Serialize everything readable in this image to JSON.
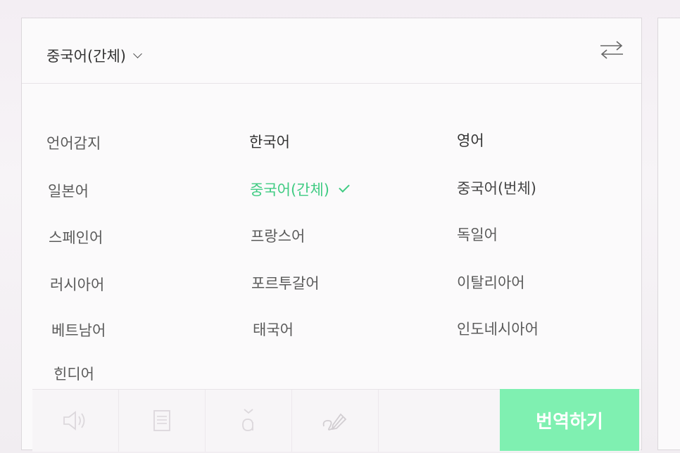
{
  "header": {
    "selected_language": "중국어(간체)"
  },
  "languages": [
    {
      "label": "언어감지",
      "active": false
    },
    {
      "label": "한국어",
      "active": false
    },
    {
      "label": "영어",
      "active": false
    },
    {
      "label": "일본어",
      "active": false
    },
    {
      "label": "중국어(간체)",
      "active": true
    },
    {
      "label": "중국어(번체)",
      "active": false
    },
    {
      "label": "스페인어",
      "active": false
    },
    {
      "label": "프랑스어",
      "active": false
    },
    {
      "label": "독일어",
      "active": false
    },
    {
      "label": "러시아어",
      "active": false
    },
    {
      "label": "포르투갈어",
      "active": false
    },
    {
      "label": "이탈리아어",
      "active": false
    },
    {
      "label": "베트남어",
      "active": false
    },
    {
      "label": "태국어",
      "active": false
    },
    {
      "label": "인도네시아어",
      "active": false
    },
    {
      "label": "힌디어",
      "active": false
    }
  ],
  "toolbar": {
    "icons": [
      "speaker-icon",
      "dictionary-icon",
      "pronunciation-icon",
      "handwriting-icon"
    ],
    "translate_label": "번역하기"
  },
  "colors": {
    "accent": "#3fcb82",
    "button": "#7ff0b1"
  }
}
